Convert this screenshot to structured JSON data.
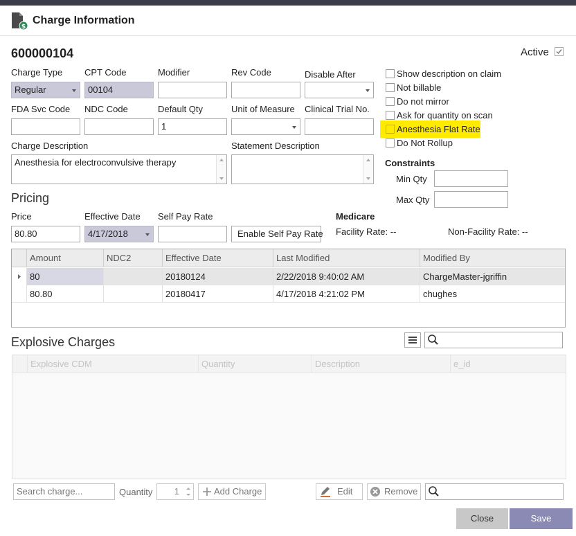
{
  "dialog": {
    "title": "Charge Information"
  },
  "charge": {
    "id": "600000104",
    "active_label": "Active",
    "active_checked": true
  },
  "fields": {
    "charge_type": {
      "label": "Charge Type",
      "value": "Regular"
    },
    "cpt_code": {
      "label": "CPT Code",
      "value": "00104"
    },
    "modifier": {
      "label": "Modifier",
      "value": ""
    },
    "rev_code": {
      "label": "Rev Code",
      "value": ""
    },
    "disable_after": {
      "label": "Disable After",
      "value": ""
    },
    "fda_svc_code": {
      "label": "FDA Svc Code",
      "value": ""
    },
    "ndc_code": {
      "label": "NDC Code",
      "value": ""
    },
    "default_qty": {
      "label": "Default Qty",
      "value": "1"
    },
    "unit_of_measure": {
      "label": "Unit of Measure",
      "value": ""
    },
    "clinical_trial_no": {
      "label": "Clinical Trial No.",
      "value": ""
    },
    "charge_description": {
      "label": "Charge Description",
      "value": "Anesthesia for electroconvulsive therapy"
    },
    "statement_description": {
      "label": "Statement Description",
      "value": ""
    }
  },
  "options": [
    {
      "label": "Show description on claim",
      "checked": false
    },
    {
      "label": "Not billable",
      "checked": false
    },
    {
      "label": "Do not mirror",
      "checked": false
    },
    {
      "label": "Ask for quantity on scan",
      "checked": false
    },
    {
      "label": "Anesthesia Flat Rate",
      "checked": false,
      "highlighted": true
    },
    {
      "label": "Do Not Rollup",
      "checked": false
    }
  ],
  "constraints": {
    "title": "Constraints",
    "min_qty_label": "Min Qty",
    "min_qty_value": "",
    "max_qty_label": "Max Qty",
    "max_qty_value": ""
  },
  "pricing": {
    "title": "Pricing",
    "price_label": "Price",
    "price_value": "80.80",
    "effective_date_label": "Effective Date",
    "effective_date_value": "4/17/2018",
    "self_pay_rate_label": "Self Pay Rate",
    "self_pay_rate_value": "",
    "enable_self_pay_button": "Enable Self Pay Rate",
    "medicare_title": "Medicare",
    "facility_rate": "Facility Rate: --",
    "non_facility_rate": "Non-Facility Rate: --"
  },
  "price_grid": {
    "columns": [
      "Amount",
      "NDC2",
      "Effective Date",
      "Last Modified",
      "Modified By"
    ],
    "rows": [
      {
        "amount": "80",
        "ndc2": "",
        "effective_date": "20180124",
        "last_modified": "2/22/2018 9:40:02 AM",
        "modified_by": "ChargeMaster-jgriffin",
        "selected": true
      },
      {
        "amount": "80.80",
        "ndc2": "",
        "effective_date": "20180417",
        "last_modified": "4/17/2018 4:21:02 PM",
        "modified_by": "chughes",
        "selected": false
      }
    ]
  },
  "explosive": {
    "title": "Explosive Charges",
    "search_placeholder": "",
    "columns": [
      "Explosive CDM",
      "Quantity",
      "Description",
      "e_id"
    ],
    "search_charge_placeholder": "Search charge...",
    "quantity_label": "Quantity",
    "quantity_value": "1",
    "add_charge_label": "Add Charge",
    "edit_label": "Edit",
    "remove_label": "Remove",
    "bottom_search_placeholder": ""
  },
  "footer": {
    "close_label": "Close",
    "save_label": "Save"
  },
  "colors": {
    "save_bg": "#8a8ab5",
    "close_bg": "#c8c8c8",
    "highlight": "#ffeb00",
    "readonly_bg": "#c9c9d9"
  }
}
